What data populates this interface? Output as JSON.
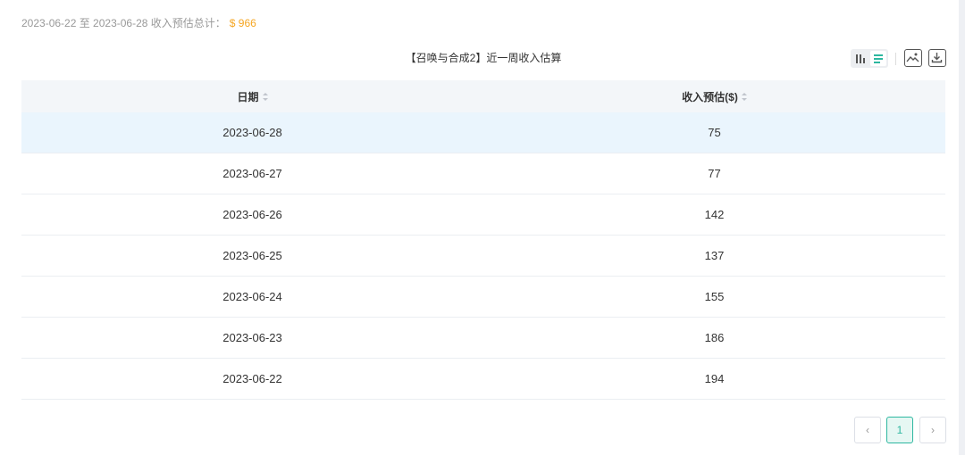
{
  "summary": {
    "text": "2023-06-22 至 2023-06-28 收入预估总计：",
    "amount": "$ 966"
  },
  "chart_title": "【召唤与合成2】近一周收入估算",
  "toolbar": {
    "bar_view": "bar-chart-icon",
    "table_view": "list-icon",
    "save_image": "image-icon",
    "download": "download-icon"
  },
  "colors": {
    "accent": "#2db7a0",
    "amount": "#f5a623",
    "highlight_row": "#eaf5fd"
  },
  "table": {
    "columns": [
      "日期",
      "收入预估($)"
    ],
    "rows": [
      {
        "date": "2023-06-28",
        "revenue": "75"
      },
      {
        "date": "2023-06-27",
        "revenue": "77"
      },
      {
        "date": "2023-06-26",
        "revenue": "142"
      },
      {
        "date": "2023-06-25",
        "revenue": "137"
      },
      {
        "date": "2023-06-24",
        "revenue": "155"
      },
      {
        "date": "2023-06-23",
        "revenue": "186"
      },
      {
        "date": "2023-06-22",
        "revenue": "194"
      }
    ]
  },
  "pagination": {
    "prev": "‹",
    "current": "1",
    "next": "›"
  }
}
